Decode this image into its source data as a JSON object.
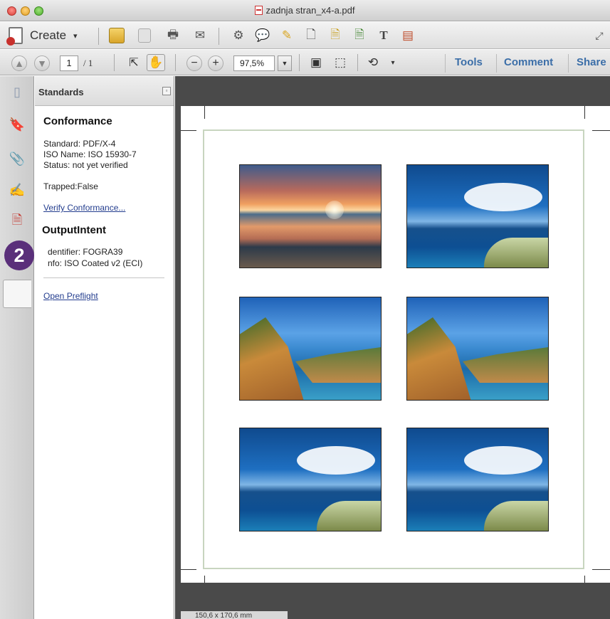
{
  "window": {
    "title": "zadnja stran_x4-a.pdf"
  },
  "toolbar": {
    "create_label": "Create",
    "page_current": "1",
    "page_total": "/ 1",
    "zoom_value": "97,5%",
    "links": [
      "Tools",
      "Comment",
      "Share"
    ]
  },
  "panel": {
    "title": "Standards",
    "conformance_heading": "Conformance",
    "standard": "Standard: PDF/X-4",
    "iso_name": "ISO Name: ISO 15930-7",
    "status": "Status: not yet verified",
    "trapped": "Trapped:False",
    "verify_link": "Verify Conformance...",
    "output_heading": "OutputIntent",
    "identifier": "dentifier: FOGRA39",
    "info": "nfo: ISO Coated v2 (ECI)",
    "preflight_link": "Open Preflight"
  },
  "badge": "2",
  "document": {
    "size_status": "150,6 x 170,6 mm"
  },
  "icons": {
    "rail": [
      "pages-icon",
      "bookmark-icon",
      "attachment-icon",
      "signature-icon",
      "standards-icon"
    ]
  }
}
